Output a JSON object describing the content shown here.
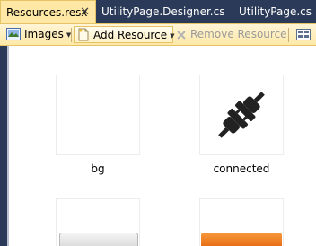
{
  "tabs": [
    {
      "label": "Resources.resx",
      "close": "✕",
      "active": true
    },
    {
      "label": "UtilityPage.Designer.cs",
      "active": false
    },
    {
      "label": "UtilityPage.cs",
      "active": false
    }
  ],
  "toolbar": {
    "images_label": "Images",
    "add_resource_label": "Add Resource",
    "remove_resource_label": "Remove Resource"
  },
  "resources": [
    {
      "name": "bg",
      "icon": "blank-image"
    },
    {
      "name": "connected",
      "icon": "plug-icon"
    },
    {
      "name": "",
      "icon": "gray-button-image"
    },
    {
      "name": "",
      "icon": "orange-button-image"
    }
  ],
  "colors": {
    "tab_active_bg": "#ffe8a6",
    "tab_strip_bg": "#2b3a58",
    "toolbar_bg": "#ffeeb8",
    "plug": "#222222",
    "orange": "#f07a1a"
  }
}
